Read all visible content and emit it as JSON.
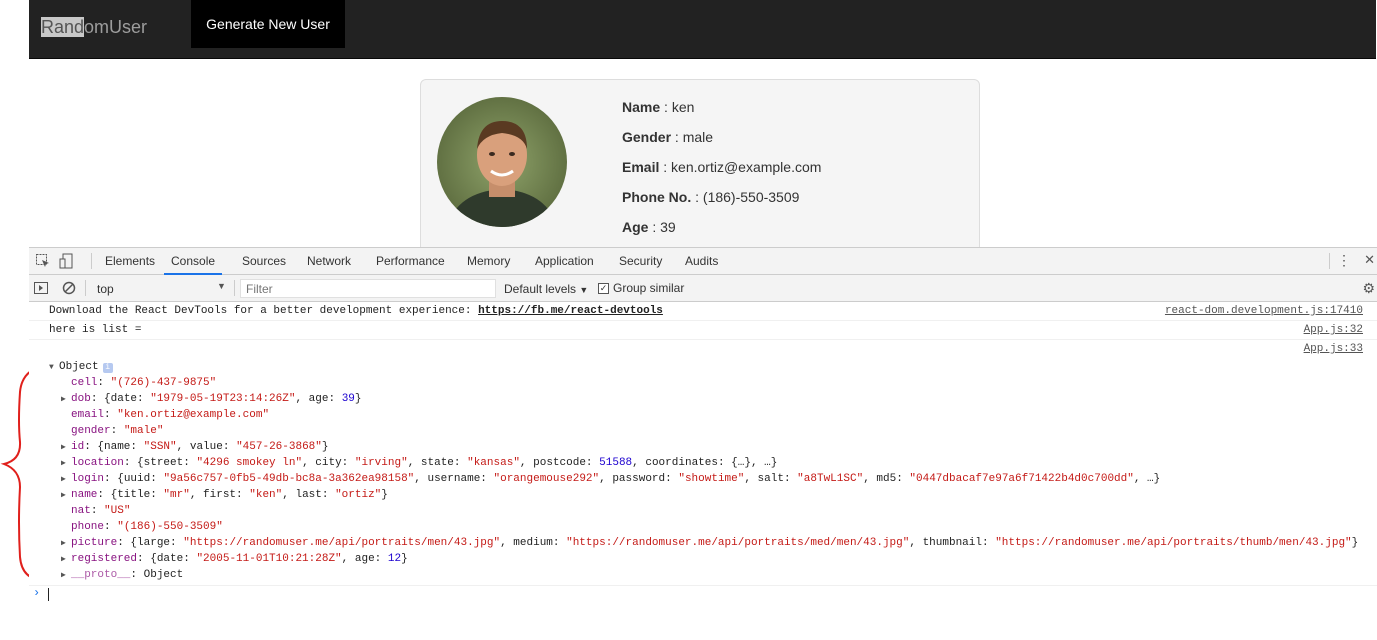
{
  "navbar": {
    "brand_selected": "Rand",
    "brand_rest": "omUser",
    "generate_button": "Generate New User"
  },
  "profile": {
    "fields": [
      {
        "label": "Name",
        "value": "ken"
      },
      {
        "label": "Gender",
        "value": "male"
      },
      {
        "label": "Email",
        "value": "ken.ortiz@example.com"
      },
      {
        "label": "Phone No.",
        "value": "(186)-550-3509"
      },
      {
        "label": "Age",
        "value": "39"
      }
    ]
  },
  "devtools": {
    "tabs": [
      "Elements",
      "Console",
      "Sources",
      "Network",
      "Performance",
      "Memory",
      "Application",
      "Security",
      "Audits"
    ],
    "active_tab": "Console",
    "context": "top",
    "filter_placeholder": "Filter",
    "levels": "Default levels",
    "group_similar": "Group similar"
  },
  "console": {
    "msg1_text": "Download the React DevTools for a better development experience: ",
    "msg1_link": "https://fb.me/react-devtools",
    "msg1_src": "react-dom.development.js:17410",
    "msg2_text": "here is list =",
    "msg2_src": "App.js:32",
    "msg3_src": "App.js:33",
    "object_label": "Object",
    "rows": [
      {
        "expand": false,
        "key": "cell",
        "html": "<span class=\"s\">\"(726)-437-9875\"</span>"
      },
      {
        "expand": true,
        "key": "dob",
        "html": "{date: <span class=\"s\">\"1979-05-19T23:14:26Z\"</span>, age: <span class=\"n\">39</span>}"
      },
      {
        "expand": false,
        "key": "email",
        "html": "<span class=\"s\">\"ken.ortiz@example.com\"</span>"
      },
      {
        "expand": false,
        "key": "gender",
        "html": "<span class=\"s\">\"male\"</span>"
      },
      {
        "expand": true,
        "key": "id",
        "html": "{name: <span class=\"s\">\"SSN\"</span>, value: <span class=\"s\">\"457-26-3868\"</span>}"
      },
      {
        "expand": true,
        "key": "location",
        "html": "{street: <span class=\"s\">\"4296 smokey ln\"</span>, city: <span class=\"s\">\"irving\"</span>, state: <span class=\"s\">\"kansas\"</span>, postcode: <span class=\"n\">51588</span>, coordinates: {…}, …}"
      },
      {
        "expand": true,
        "key": "login",
        "html": "{uuid: <span class=\"s\">\"9a56c757-0fb5-49db-bc8a-3a362ea98158\"</span>, username: <span class=\"s\">\"orangemouse292\"</span>, password: <span class=\"s\">\"showtime\"</span>, salt: <span class=\"s\">\"a8TwL1SC\"</span>, md5: <span class=\"s\">\"0447dbacaf7e97a6f71422b4d0c700dd\"</span>, …}"
      },
      {
        "expand": true,
        "key": "name",
        "html": "{title: <span class=\"s\">\"mr\"</span>, first: <span class=\"s\">\"ken\"</span>, last: <span class=\"s\">\"ortiz\"</span>}"
      },
      {
        "expand": false,
        "key": "nat",
        "html": "<span class=\"s\">\"US\"</span>"
      },
      {
        "expand": false,
        "key": "phone",
        "html": "<span class=\"s\">\"(186)-550-3509\"</span>"
      },
      {
        "expand": true,
        "key": "picture",
        "html": "{large: <span class=\"s\">\"https://randomuser.me/api/portraits/men/43.jpg\"</span>, medium: <span class=\"s\">\"https://randomuser.me/api/portraits/med/men/43.jpg\"</span>, thumbnail: <span class=\"s\">\"https://randomuser.me/api/portraits/thumb/men/43.jpg\"</span>}"
      },
      {
        "expand": true,
        "key": "registered",
        "html": "{date: <span class=\"s\">\"2005-11-01T10:21:28Z\"</span>, age: <span class=\"n\">12</span>}"
      },
      {
        "expand": true,
        "key": "__proto__",
        "html": "Object",
        "proto": true
      }
    ]
  }
}
